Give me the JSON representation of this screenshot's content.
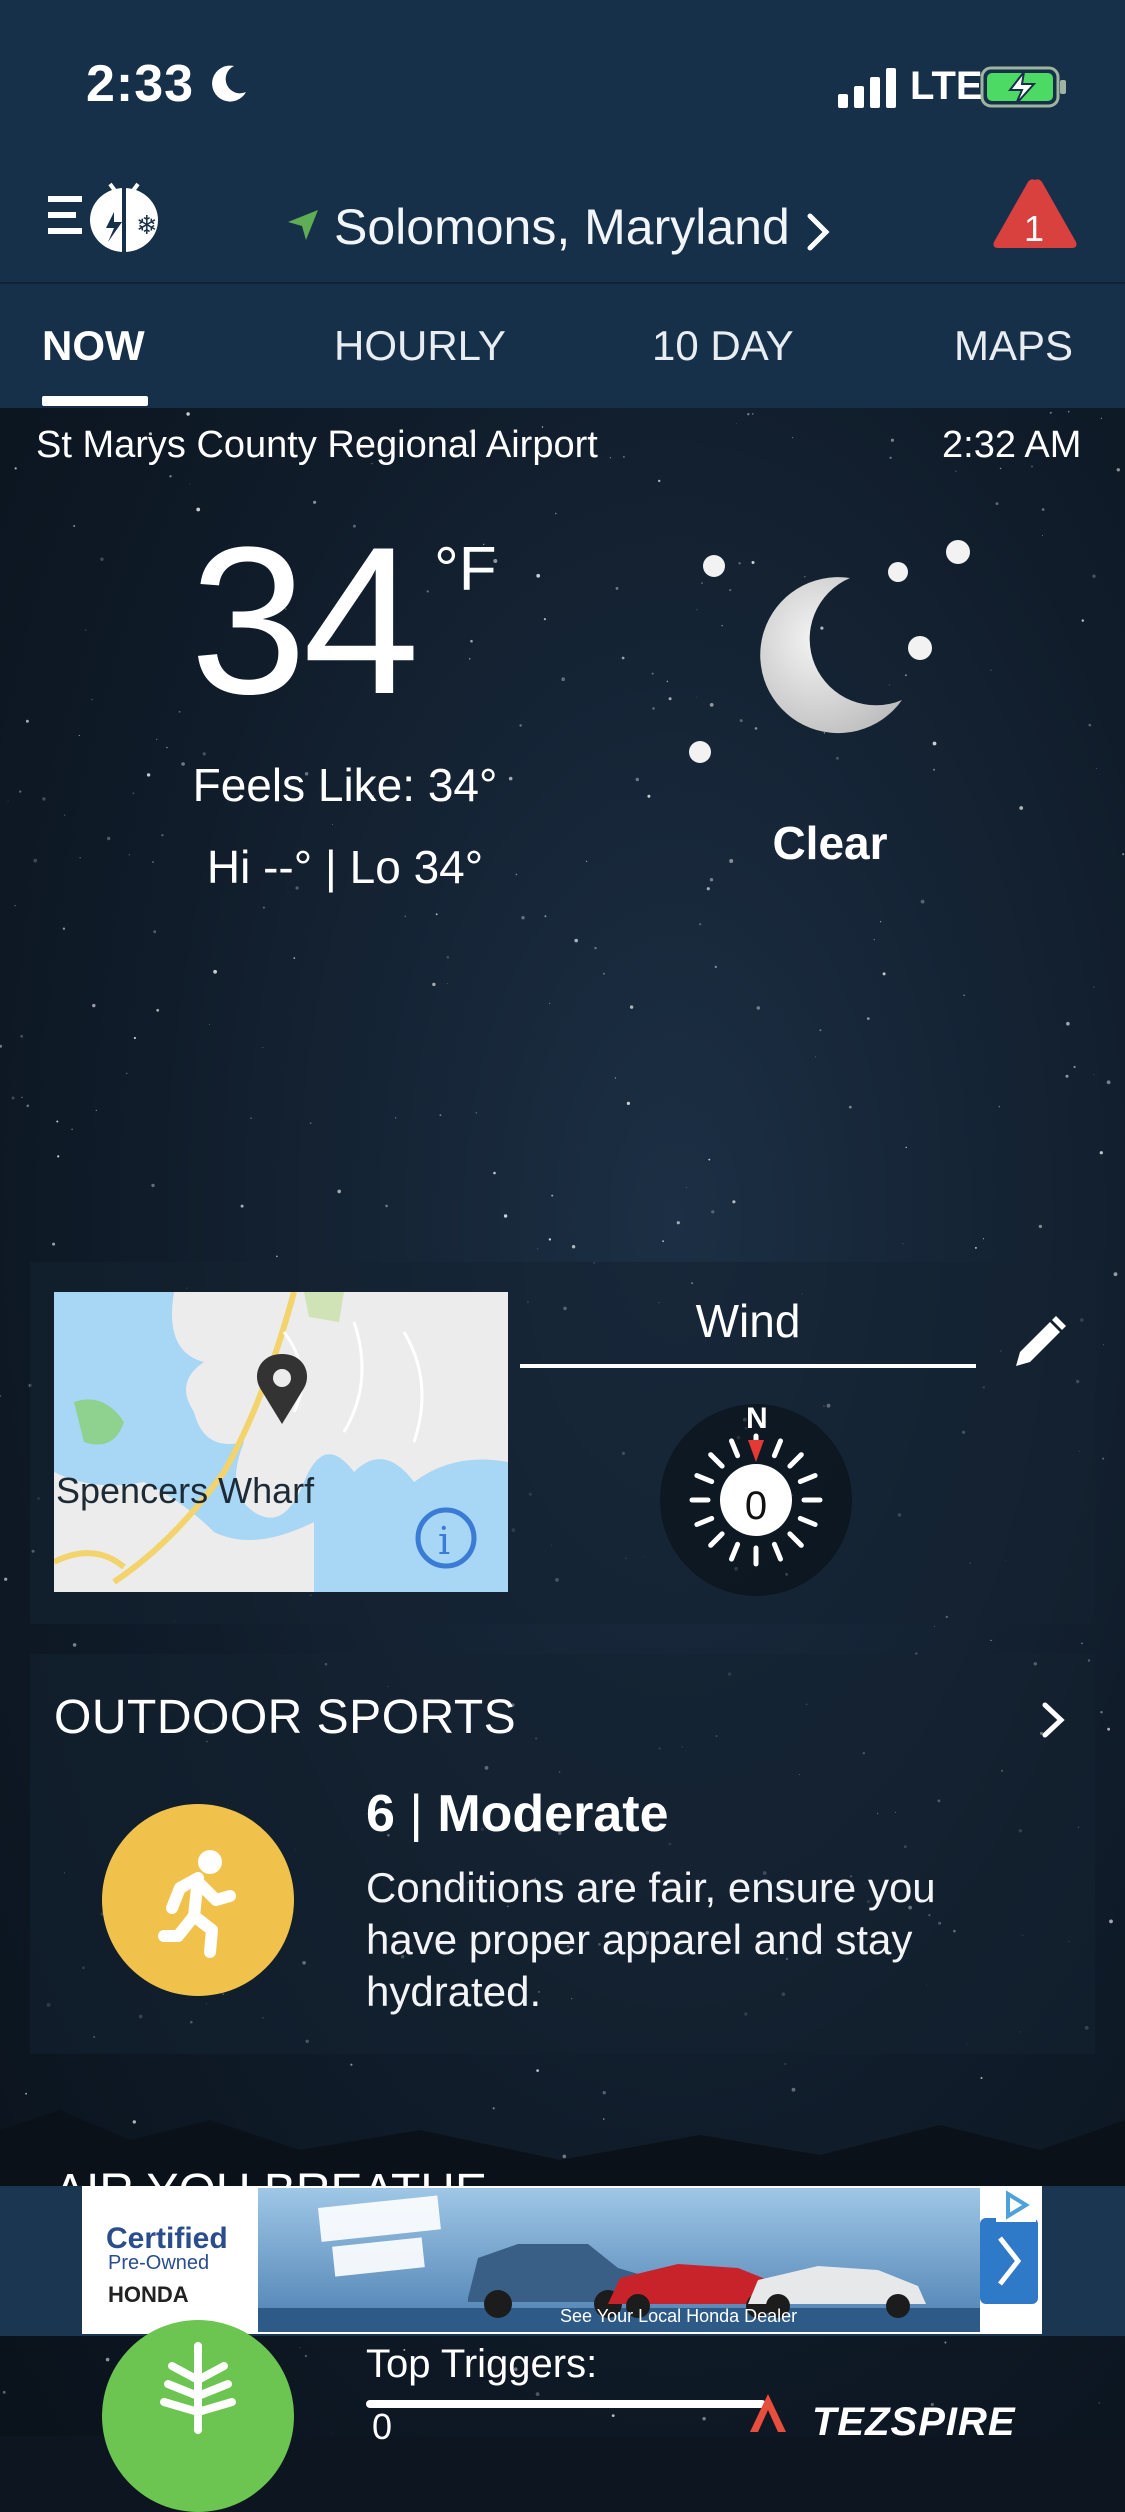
{
  "status_bar": {
    "time": "2:33",
    "network": "LTE"
  },
  "header": {
    "location": "Solomons,  Maryland",
    "alert_count": "1"
  },
  "tabs": [
    {
      "label": "NOW",
      "active": true
    },
    {
      "label": "HOURLY",
      "active": false
    },
    {
      "label": "10  DAY",
      "active": false
    },
    {
      "label": "MAPS",
      "active": false
    }
  ],
  "current": {
    "station": "St Marys County Regional Airport",
    "observed_time": "2:32 AM",
    "temperature": "34",
    "unit": "°F",
    "feels_like": "Feels Like: 34°",
    "hi_lo": "Hi --° | Lo 34°",
    "condition": "Clear",
    "condition_icon": "moon-stars-icon"
  },
  "map_tile": {
    "place_label": "Spencers Wharf"
  },
  "wind": {
    "title": "Wind",
    "direction_label": "N",
    "speed": "0"
  },
  "outdoor_sports": {
    "title": "OUTDOOR SPORTS",
    "score": "6",
    "rating": "Moderate",
    "description": "Conditions are fair, ensure you have proper apparel and stay hydrated."
  },
  "next_section": {
    "title_partial": "AIR YOU BREATHE"
  },
  "ad": {
    "brand_line1": "Certified",
    "brand_line2": "Pre-Owned",
    "brand_line3": "HONDA",
    "footer": "See Your Local Honda Dealer"
  },
  "air_quality": {
    "triggers_label": "Top Triggers:",
    "trigger_value": "0",
    "sponsor": "TEZSPIRE"
  },
  "colors": {
    "header_bg": "#173049",
    "alert_red": "#d9413f",
    "sports_yellow": "#f1c24b",
    "air_green": "#6cc551",
    "location_arrow": "#5fae55"
  }
}
